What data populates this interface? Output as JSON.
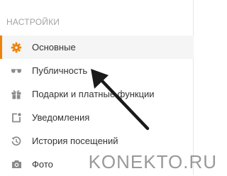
{
  "settings": {
    "section_title": "НАСТРОЙКИ",
    "items": [
      {
        "label": "Основные",
        "icon": "gear-icon",
        "active": true
      },
      {
        "label": "Публичность",
        "icon": "sunglasses-icon",
        "active": false
      },
      {
        "label": "Подарки и платные функции",
        "icon": "gift-icon",
        "active": false
      },
      {
        "label": "Уведомления",
        "icon": "notification-icon",
        "active": false
      },
      {
        "label": "История посещений",
        "icon": "history-icon",
        "active": false
      },
      {
        "label": "Фото",
        "icon": "camera-icon",
        "active": false
      }
    ]
  },
  "colors": {
    "accent": "#ee8208",
    "icon": "#8a8a8a"
  },
  "watermark": "KONEKTO.RU"
}
